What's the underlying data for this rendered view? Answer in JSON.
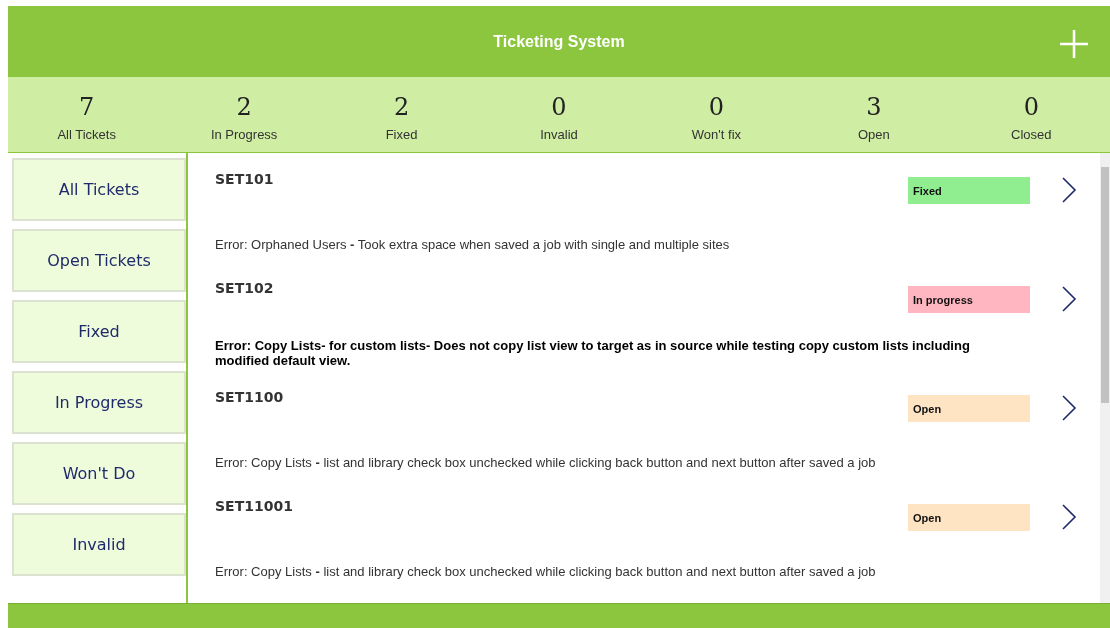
{
  "header": {
    "title": "Ticketing System"
  },
  "stats": [
    {
      "count": "7",
      "label": "All Tickets"
    },
    {
      "count": "2",
      "label": "In Progress"
    },
    {
      "count": "2",
      "label": "Fixed"
    },
    {
      "count": "0",
      "label": "Invalid"
    },
    {
      "count": "0",
      "label": "Won't fix"
    },
    {
      "count": "3",
      "label": "Open"
    },
    {
      "count": "0",
      "label": "Closed"
    }
  ],
  "sidebar": {
    "items": [
      {
        "label": "All Tickets"
      },
      {
        "label": "Open Tickets"
      },
      {
        "label": "Fixed"
      },
      {
        "label": "In Progress"
      },
      {
        "label": "Won't Do"
      },
      {
        "label": "Invalid"
      }
    ]
  },
  "tickets": [
    {
      "id": "SET101",
      "status": "Fixed",
      "color": "#90ee90",
      "bold": false,
      "description": "Error: Orphaned Users **-** Took extra space when saved a job with single and multiple sites"
    },
    {
      "id": "SET102",
      "status": "In progress",
      "color": "#ffb6c1",
      "bold": true,
      "description": "Error: Copy Lists- for custom lists- Does not copy list view to target as in source while testing copy custom lists including modified default view."
    },
    {
      "id": "SET1100",
      "status": "Open",
      "color": "#ffe4c4",
      "bold": false,
      "description": "Error: Copy Lists **-** list and library check box unchecked while clicking back button and next button after saved a job"
    },
    {
      "id": "SET11001",
      "status": "Open",
      "color": "#ffe4c4",
      "bold": false,
      "description": "Error: Copy Lists **-** list and library check box unchecked while clicking back button and next button after saved a job"
    }
  ]
}
